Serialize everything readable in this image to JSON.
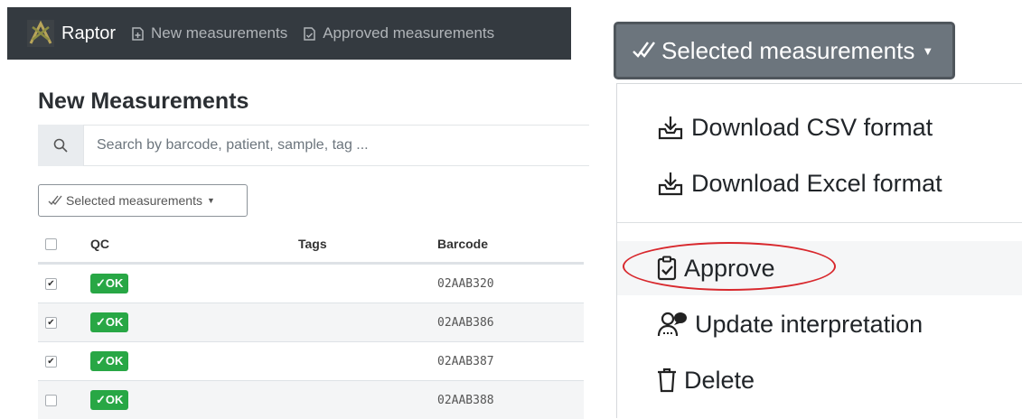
{
  "navbar": {
    "brand": "Raptor",
    "links": [
      {
        "label": "New measurements",
        "icon": "document-plus-icon"
      },
      {
        "label": "Approved measurements",
        "icon": "document-check-icon"
      }
    ]
  },
  "page": {
    "title": "New Measurements",
    "search_placeholder": "Search by barcode, patient, sample, tag ...",
    "bulk_dropdown": "Selected measurements"
  },
  "table": {
    "headers": [
      "QC",
      "Tags",
      "Barcode"
    ],
    "rows": [
      {
        "checked": true,
        "qc": "✓OK",
        "tags": "",
        "barcode": "02AAB320"
      },
      {
        "checked": true,
        "qc": "✓OK",
        "tags": "",
        "barcode": "02AAB386"
      },
      {
        "checked": true,
        "qc": "✓OK",
        "tags": "",
        "barcode": "02AAB387"
      },
      {
        "checked": false,
        "qc": "✓OK",
        "tags": "",
        "barcode": "02AAB388"
      }
    ]
  },
  "zoom": {
    "button_label": "Selected measurements",
    "menu": [
      {
        "label": "Download CSV format",
        "icon": "download-icon"
      },
      {
        "label": "Download Excel format",
        "icon": "download-icon"
      },
      {
        "label": "Approve",
        "icon": "clipboard-check-icon",
        "highlighted": true
      },
      {
        "label": "Update interpretation",
        "icon": "users-comment-icon"
      },
      {
        "label": "Delete",
        "icon": "trash-icon"
      }
    ]
  },
  "colors": {
    "navbar": "#343a40",
    "badge_ok": "#28a745",
    "button": "#6c757d",
    "highlight_circle": "#d8282d"
  }
}
